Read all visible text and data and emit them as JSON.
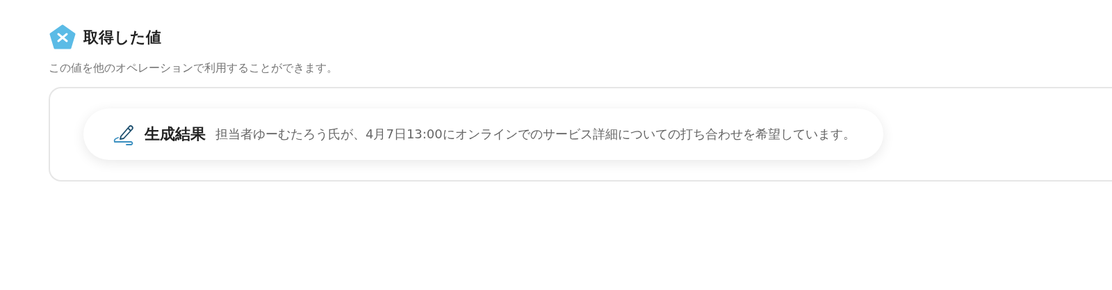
{
  "section": {
    "title": "取得した値",
    "description": "この値を他のオペレーションで利用することができます。"
  },
  "values": [
    {
      "label": "生成結果",
      "value": "担当者ゆーむたろう氏が、4月7日13:00にオンラインでのサービス詳細についての打ち合わせを希望しています。"
    }
  ]
}
